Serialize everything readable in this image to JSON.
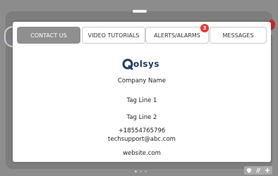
{
  "tabs": [
    {
      "label": "CONTACT US",
      "active": true
    },
    {
      "label": "VIDEO TUTORIALS",
      "active": false
    },
    {
      "label": "ALERTS/ALARMS",
      "active": false,
      "badge": "3"
    },
    {
      "label": "MESSAGES",
      "active": false
    }
  ],
  "contact": {
    "logo_text": "olsys",
    "company_name": "Company Name",
    "tag_line_1": "Tag Line 1",
    "tag_line_2": "Tag Line 2",
    "phone": "+18554765796",
    "email": "techsupport@abc.com",
    "website": "website.com"
  },
  "icons": {
    "logo": "qolsys-logo-icon",
    "bottom_right": [
      "shield-icon",
      "slash-icon",
      "plus-icon"
    ]
  },
  "colors": {
    "active_tab": "#8f8f8f",
    "badge": "#e53935",
    "logo": "#253a6c"
  },
  "pager": {
    "count": 3,
    "active_index": 0
  }
}
